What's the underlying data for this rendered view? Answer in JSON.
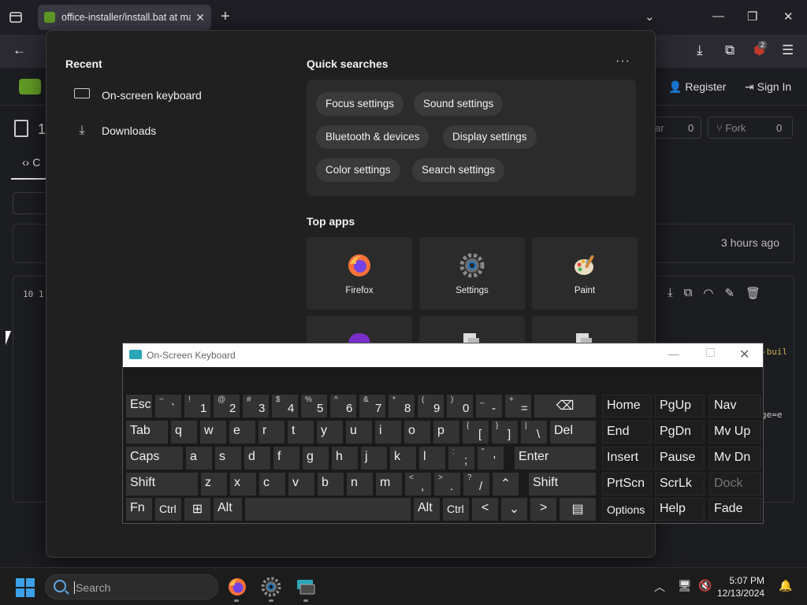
{
  "browser": {
    "tab_title": "office-installer/install.bat at ma",
    "tab_close": "✕",
    "new_tab": "+",
    "notification_badge": "2"
  },
  "gitea": {
    "register": "Register",
    "sign_in": "Sign In",
    "repo_num": "1",
    "star_label": "ar",
    "star_count": "0",
    "fork_label": "Fork",
    "fork_count": "0",
    "code_tab": "C",
    "commit_time": "3 hours ago",
    "file_meta": "10 1",
    "code_fragment_1": "-buil",
    "code_fragment_2": "ge=e"
  },
  "flyout": {
    "recent_title": "Recent",
    "recent_items": [
      "On-screen keyboard",
      "Downloads"
    ],
    "quick_title": "Quick searches",
    "more": "···",
    "quick_chips": [
      "Focus settings",
      "Sound settings",
      "Bluetooth & devices",
      "Display settings",
      "Color settings",
      "Search settings"
    ],
    "top_apps_title": "Top apps",
    "top_apps": [
      "Firefox",
      "Settings",
      "Paint"
    ]
  },
  "osk": {
    "title": "On-Screen Keyboard",
    "rows": [
      [
        "Esc",
        "~ `",
        "! 1",
        "@ 2",
        "# 3",
        "$ 4",
        "% 5",
        "^ 6",
        "& 7",
        "* 8",
        "( 9",
        ") 0",
        "_ -",
        "+ =",
        "⌫",
        "Home",
        "PgUp",
        "Nav"
      ],
      [
        "Tab",
        "q",
        "w",
        "e",
        "r",
        "t",
        "y",
        "u",
        "i",
        "o",
        "p",
        "{ [",
        "} ]",
        "| \\",
        "Del",
        "End",
        "PgDn",
        "Mv Up"
      ],
      [
        "Caps",
        "a",
        "s",
        "d",
        "f",
        "g",
        "h",
        "j",
        "k",
        "l",
        ": ;",
        "\" '",
        "Enter",
        "Insert",
        "Pause",
        "Mv Dn"
      ],
      [
        "Shift",
        "z",
        "x",
        "c",
        "v",
        "b",
        "n",
        "m",
        "< ,",
        "> .",
        "? /",
        "⌃",
        "Shift",
        "PrtScn",
        "ScrLk",
        "Dock"
      ],
      [
        "Fn",
        "Ctrl",
        "⊞",
        "Alt",
        "",
        "Alt",
        "Ctrl",
        "<",
        "⌄",
        ">",
        "▤",
        "Options",
        "Help",
        "Fade"
      ]
    ]
  },
  "taskbar": {
    "search_placeholder": "Search",
    "time": "5:07 PM",
    "date": "12/13/2024"
  }
}
